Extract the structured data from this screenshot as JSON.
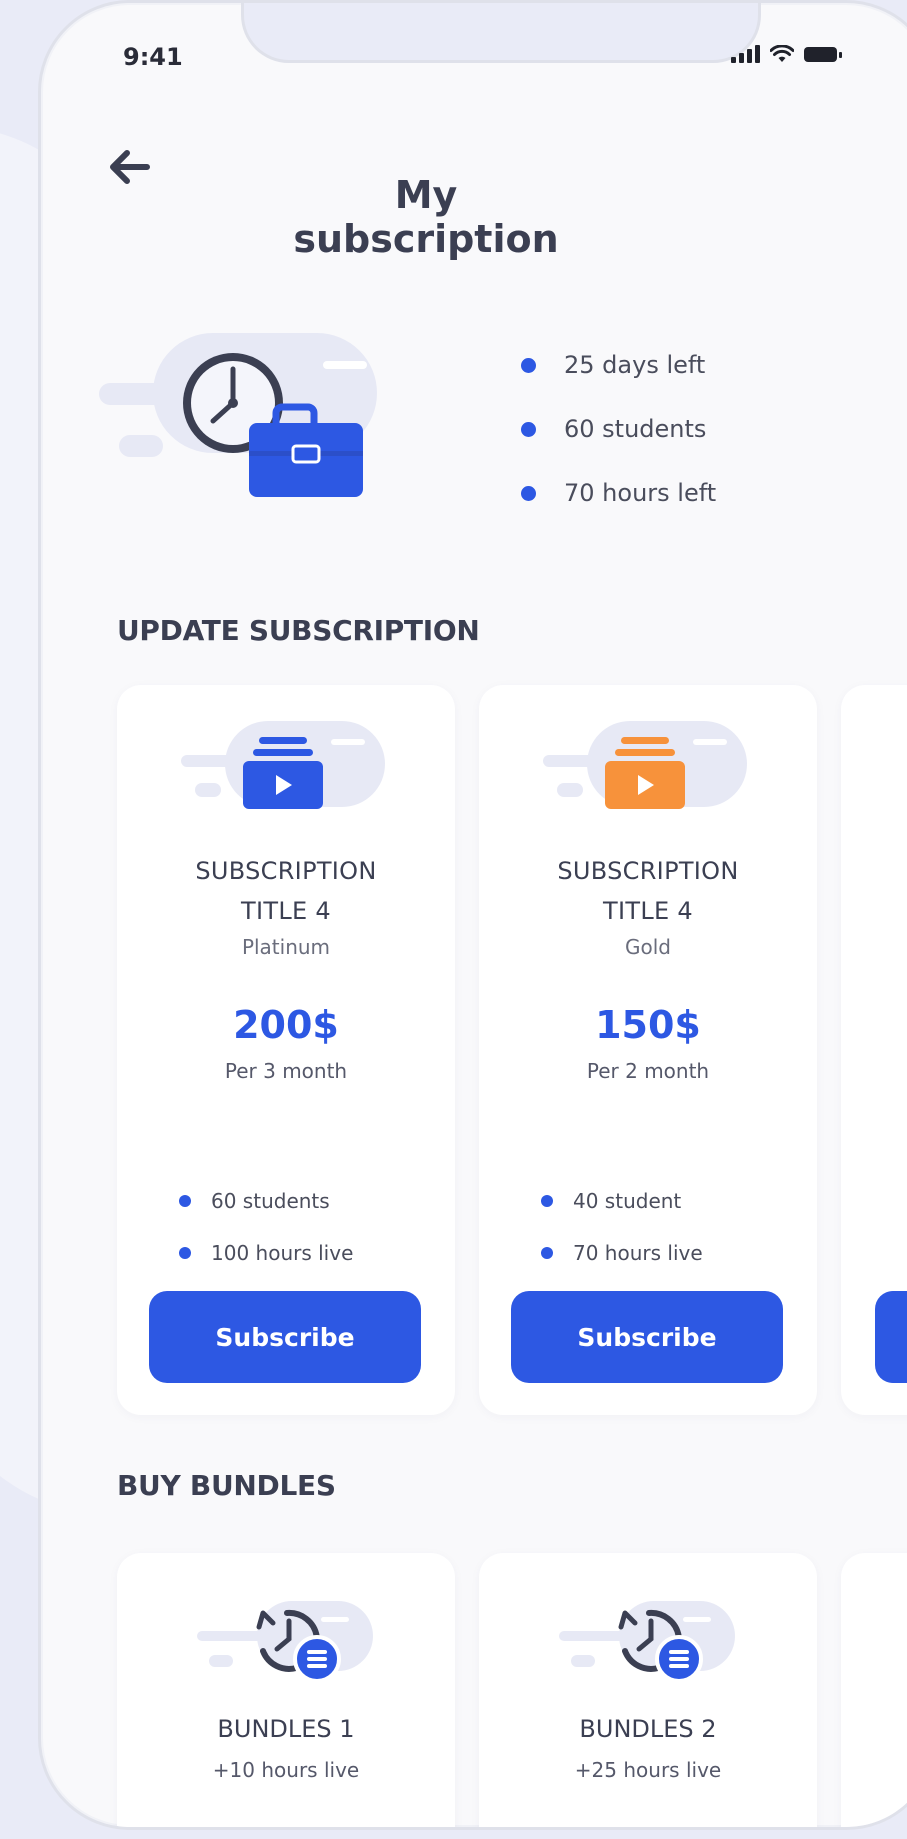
{
  "status_bar": {
    "time": "9:41"
  },
  "header": {
    "title": "My subscription"
  },
  "summary": {
    "stats": [
      "25 days left",
      "60 students",
      "70 hours left"
    ]
  },
  "update_section": {
    "title": "UPDATE SUBSCRIPTION",
    "cards": [
      {
        "title_line1": "SUBSCRIPTION",
        "title_line2": "TITLE 4",
        "tier": "Platinum",
        "price": "200$",
        "period": "Per 3 month",
        "features": [
          "60 students",
          "100 hours live"
        ],
        "button": "Subscribe",
        "icon_color": "#2d58e3"
      },
      {
        "title_line1": "SUBSCRIPTION",
        "title_line2": "TITLE 4",
        "tier": "Gold",
        "price": "150$",
        "period": "Per 2 month",
        "features": [
          "40 student",
          "70 hours live"
        ],
        "button": "Subscribe",
        "icon_color": "#f7923b"
      }
    ]
  },
  "bundles_section": {
    "title": "BUY BUNDLES",
    "bundles": [
      {
        "title": "BUNDLES 1",
        "subtitle": "+10 hours live"
      },
      {
        "title": "BUNDLES 2",
        "subtitle": "+25 hours live"
      }
    ]
  },
  "colors": {
    "accent": "#2d58e3",
    "gold": "#f7923b",
    "background": "#f9f9fb"
  },
  "icons": [
    "back-arrow-icon",
    "clock-icon",
    "briefcase-icon",
    "video-folder-icon",
    "clock-list-icon",
    "signal-icon",
    "wifi-icon",
    "battery-icon"
  ]
}
